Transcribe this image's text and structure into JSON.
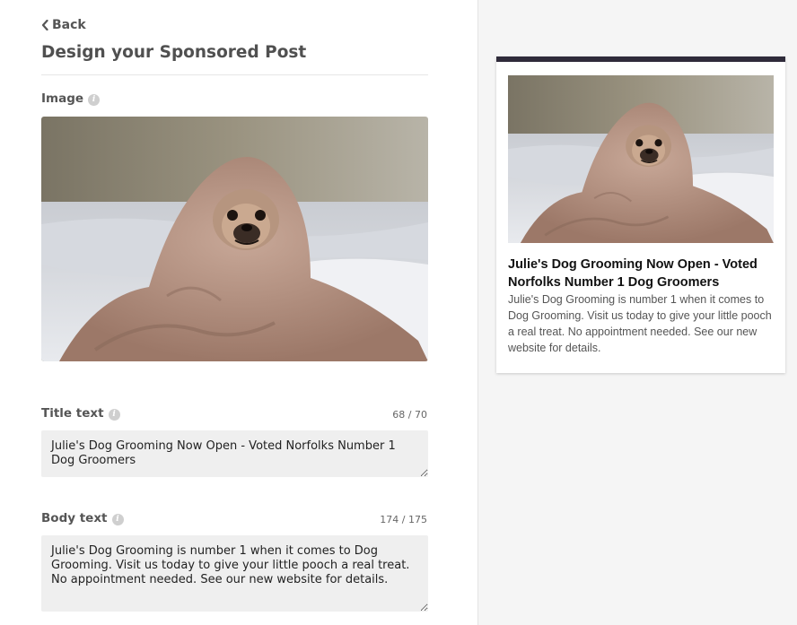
{
  "nav": {
    "back_label": "Back"
  },
  "page": {
    "title": "Design your Sponsored Post"
  },
  "image_section": {
    "label": "Image",
    "image_alt": "pug-in-blanket-photo"
  },
  "title_field": {
    "label": "Title text",
    "counter": "68 / 70",
    "value": "Julie's Dog Grooming Now Open - Voted Norfolks Number 1 Dog Groomers"
  },
  "body_field": {
    "label": "Body text",
    "counter": "174 / 175",
    "value": "Julie's Dog Grooming is number 1 when it comes to Dog Grooming. Visit us today to give your little pooch a real treat. No appointment needed. See our new website for details."
  },
  "preview": {
    "title": "Julie's Dog Grooming Now Open - Voted Norfolks Number 1 Dog Groomers",
    "body": "Julie's Dog Grooming is number 1 when it comes to Dog Grooming. Visit us today to give your little pooch a real treat. No appointment needed. See our new website for details."
  },
  "icons": {
    "back": "chevron-left-icon",
    "info": "info-icon"
  },
  "colors": {
    "card_top_bar": "#2f2b3a",
    "field_bg": "#efefef",
    "panel_bg": "#f5f5f5"
  }
}
